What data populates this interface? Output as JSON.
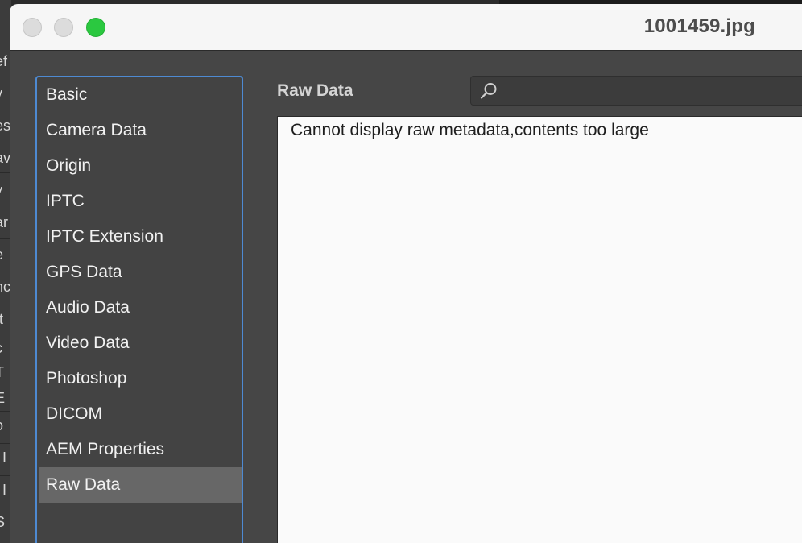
{
  "window": {
    "title": "1001459.jpg"
  },
  "background_fragments": [
    "ef",
    "y",
    "es",
    "av",
    "y",
    "ar",
    "e",
    "nc",
    "It",
    "c",
    "T",
    "E",
    "o",
    "l I",
    "l I",
    "S"
  ],
  "sidebar": {
    "items": [
      {
        "label": "Basic"
      },
      {
        "label": "Camera Data"
      },
      {
        "label": "Origin"
      },
      {
        "label": "IPTC"
      },
      {
        "label": "IPTC Extension"
      },
      {
        "label": "GPS Data"
      },
      {
        "label": "Audio Data"
      },
      {
        "label": "Video Data"
      },
      {
        "label": "Photoshop"
      },
      {
        "label": "DICOM"
      },
      {
        "label": "AEM Properties"
      },
      {
        "label": "Raw Data"
      }
    ],
    "selected_label": "Raw Data"
  },
  "panel": {
    "heading": "Raw Data",
    "search": {
      "value": "",
      "placeholder": ""
    },
    "message": "Cannot display raw metadata,contents too large"
  },
  "colors": {
    "accent": "#4e8ad2",
    "selected_item": "#676767",
    "zoom_button": "#2bc840"
  },
  "icons": {
    "search": "search-icon"
  }
}
